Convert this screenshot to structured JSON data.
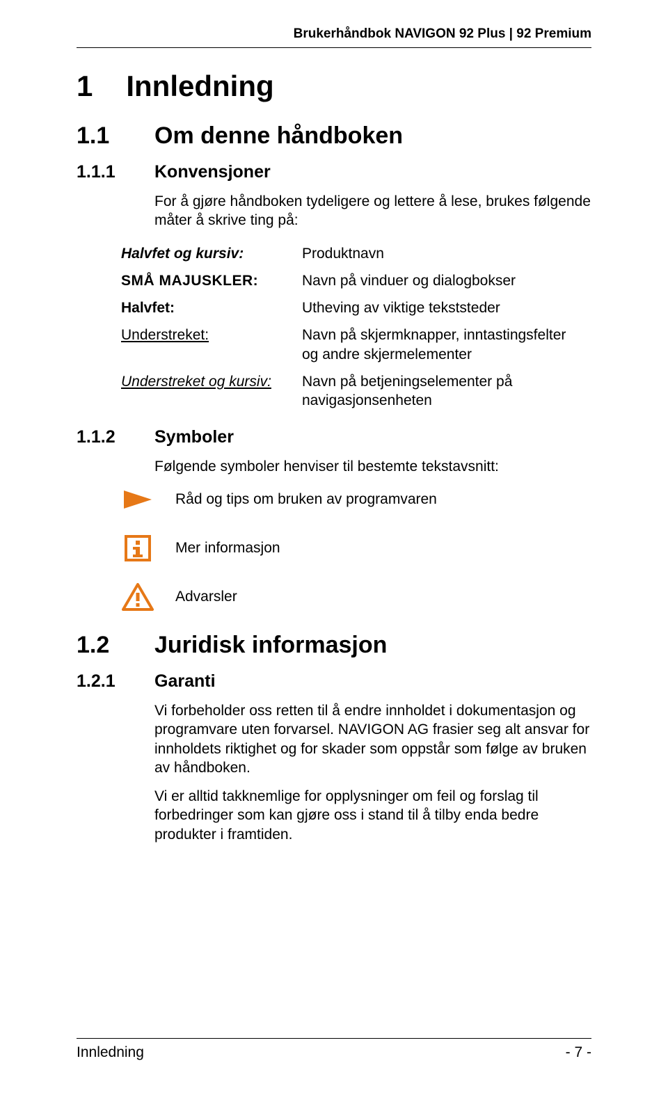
{
  "header": {
    "title": "Brukerhåndbok NAVIGON 92 Plus | 92 Premium"
  },
  "s1": {
    "num": "1",
    "title": "Innledning"
  },
  "s11": {
    "num": "1.1",
    "title": "Om denne håndboken"
  },
  "s111": {
    "num": "1.1.1",
    "title": "Konvensjoner",
    "intro": "For å gjøre håndboken tydeligere og lettere å lese, brukes følgende måter å skrive ting på:"
  },
  "conv": {
    "r1": {
      "key": "Halvfet og kursiv:",
      "val": "Produktnavn"
    },
    "r2": {
      "key": "SMÅ MAJUSKLER:",
      "val": "Navn på vinduer og dialogbokser"
    },
    "r3": {
      "key": "Halvfet:",
      "val": "Utheving av viktige tekststeder"
    },
    "r4": {
      "key": "Understreket:",
      "val": "Navn på skjermknapper, inntastingsfelter og andre skjermelementer"
    },
    "r5": {
      "key": "Understreket og kursiv:",
      "val": "Navn på betjeningselementer på navigasjonsenheten"
    }
  },
  "s112": {
    "num": "1.1.2",
    "title": "Symboler",
    "intro": "Følgende symboler henviser til bestemte tekstavsnitt:"
  },
  "symbols": {
    "tip": "Råd og tips om bruken av programvaren",
    "info": "Mer informasjon",
    "warn": "Advarsler"
  },
  "s12": {
    "num": "1.2",
    "title": "Juridisk informasjon"
  },
  "s121": {
    "num": "1.2.1",
    "title": "Garanti",
    "p1": "Vi forbeholder oss retten til å endre innholdet i dokumentasjon og programvare uten forvarsel. NAVIGON AG frasier seg alt ansvar for innholdets riktighet og for skader som oppstår som følge av bruken av håndboken.",
    "p2": "Vi er alltid takknemlige for opplysninger om feil og forslag til forbedringer som kan gjøre oss i stand til å tilby enda bedre produkter i framtiden."
  },
  "footer": {
    "left": "Innledning",
    "right": "- 7 -"
  },
  "colors": {
    "accent": "#E67817"
  }
}
